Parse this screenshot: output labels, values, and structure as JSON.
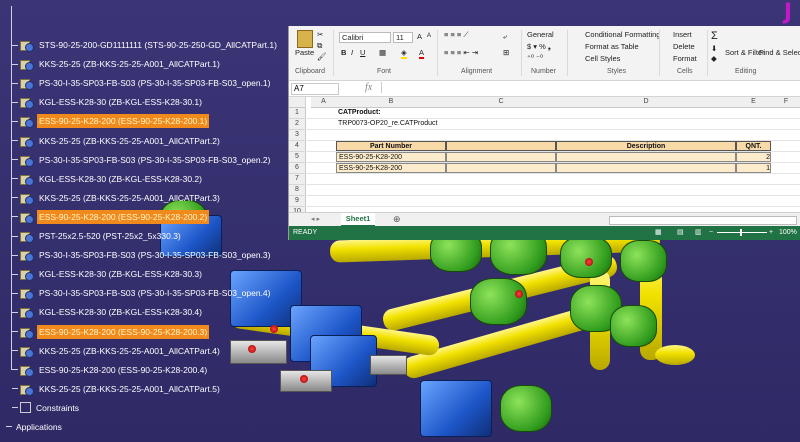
{
  "tree": {
    "nodes": [
      {
        "label": "STS-90-25-200-GD1111111 (STS-90-25-250-GD_AllCATPart.1)",
        "selected": false
      },
      {
        "label": "KKS-25-25 (ZB-KKS-25-25-A001_AllCATPart.1)",
        "selected": false
      },
      {
        "label": "PS-30-I-35-SP03-FB-S03 (PS-30-I-35-SP03-FB-S03_open.1)",
        "selected": false
      },
      {
        "label": "KGL-ESS-K28-30 (ZB-KGL-ESS-K28-30.1)",
        "selected": false
      },
      {
        "label": "ESS-90-25-K28-200 (ESS-90-25-K28-200.1)",
        "selected": true
      },
      {
        "label": "KKS-25-25 (ZB-KKS-25-25-A001_AllCATPart.2)",
        "selected": false
      },
      {
        "label": "PS-30-I-35-SP03-FB-S03 (PS-30-I-35-SP03-FB-S03_open.2)",
        "selected": false
      },
      {
        "label": "KGL-ESS-K28-30 (ZB-KGL-ESS-K28-30.2)",
        "selected": false
      },
      {
        "label": "KKS-25-25 (ZB-KKS-25-25-A001_AllCATPart.3)",
        "selected": false
      },
      {
        "label": "ESS-90-25-K28-200 (ESS-90-25-K28-200.2)",
        "selected": true
      },
      {
        "label": "PST-25x2.5-520 (PST-25x2_5x330.3)",
        "selected": false
      },
      {
        "label": "PS-30-I-35-SP03-FB-S03 (PS-30-I-35-SP03-FB-S03_open.3)",
        "selected": false
      },
      {
        "label": "KGL-ESS-K28-30 (ZB-KGL-ESS-K28-30.3)",
        "selected": false
      },
      {
        "label": "PS-30-I-35-SP03-FB-S03 (PS-30-I-35-SP03-FB-S03_open.4)",
        "selected": false
      },
      {
        "label": "KGL-ESS-K28-30 (ZB-KGL-ESS-K28-30.4)",
        "selected": false
      },
      {
        "label": "ESS-90-25-K28-200 (ESS-90-25-K28-200.3)",
        "selected": true
      },
      {
        "label": "KKS-25-25 (ZB-KKS-25-25-A001_AllCATPart.4)",
        "selected": false
      },
      {
        "label": "ESS-90-25-K28-200 (ESS-90-25-K28-200.4)",
        "selected": false
      },
      {
        "label": "KKS-25-25 (ZB-KKS-25-25-A001_AllCATPart.5)",
        "selected": false
      }
    ],
    "constraints": "Constraints",
    "applications": "Applications"
  },
  "excel": {
    "ribbon": {
      "paste": "Paste",
      "font_name": "Calibri",
      "font_size": "11",
      "number_format": "General",
      "conditional_formatting": "Conditional Formatting",
      "format_as_table": "Format as Table",
      "cell_styles": "Cell Styles",
      "insert": "Insert",
      "delete": "Delete",
      "format": "Format",
      "sort_filter": "Sort & Filter",
      "find_select": "Find & Select",
      "groups": [
        "Clipboard",
        "Font",
        "Alignment",
        "Number",
        "Styles",
        "Cells",
        "Editing"
      ]
    },
    "name_box": "A7",
    "fx_symbol": "fx",
    "columns": [
      "A",
      "B",
      "C",
      "D",
      "E",
      "F"
    ],
    "rows": [
      "1",
      "2",
      "3",
      "4",
      "5",
      "6",
      "7",
      "8",
      "9",
      "10"
    ],
    "cells": {
      "b1": "CATProduct:",
      "b2": "TRP0073-OP20_re.CATProduct"
    },
    "table": {
      "headers": {
        "part_number": "Part Number",
        "description": "Description",
        "qnt": "QNT."
      },
      "rows": [
        {
          "part_number": "ESS-90-25-K28-200",
          "description": "",
          "qnt": "2"
        },
        {
          "part_number": "ESS-90-25-K28-200",
          "description": "",
          "qnt": "1"
        }
      ]
    },
    "sheet_tab": "Sheet1",
    "status": "READY",
    "zoom": "100%"
  },
  "colors": {
    "background": "#3a3470",
    "selection": "#f08a1c",
    "pipe": "#f2e200",
    "clamp_green": "#2f9b1c",
    "clamp_blue": "#1d56c8",
    "excel_green": "#217346"
  }
}
